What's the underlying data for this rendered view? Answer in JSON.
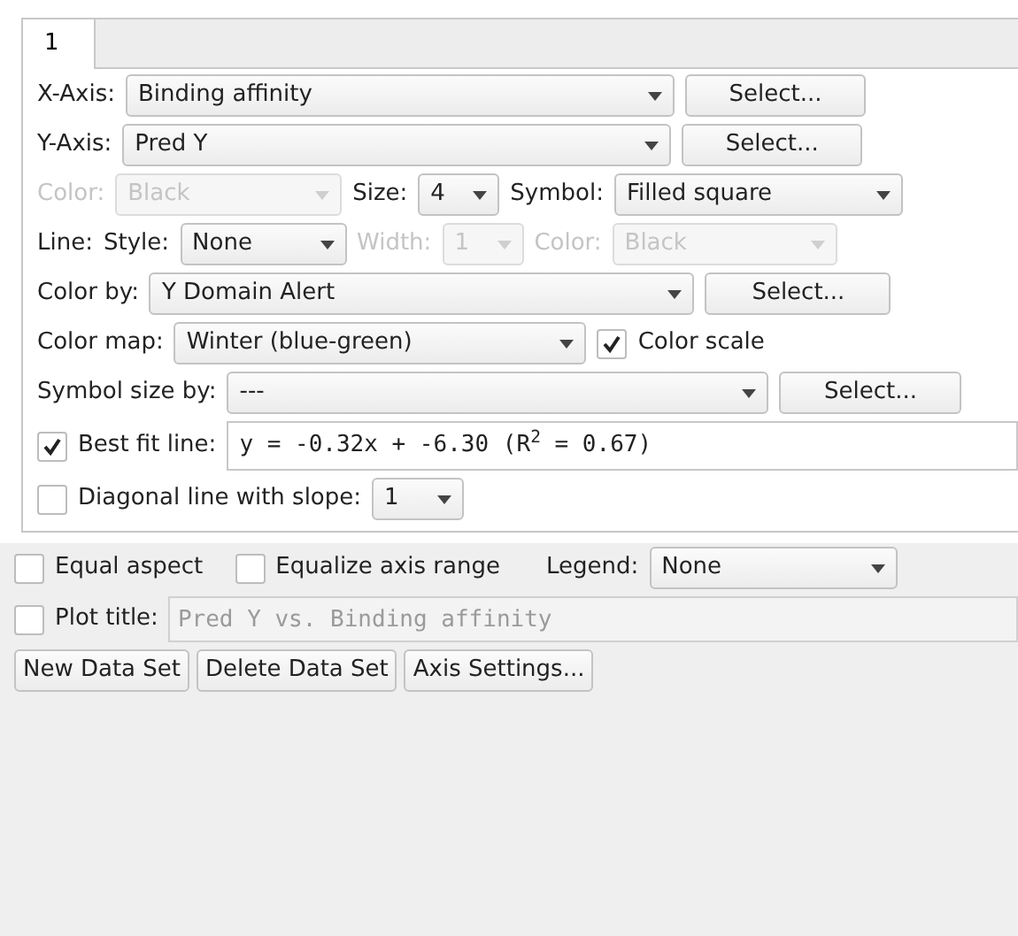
{
  "tabs": [
    {
      "label": "1",
      "selected": true
    }
  ],
  "x_axis": {
    "label": "X-Axis:",
    "value": "Binding affinity",
    "button": "Select..."
  },
  "y_axis": {
    "label": "Y-Axis:",
    "value": "Pred Y",
    "button": "Select..."
  },
  "symbol_row": {
    "color_label": "Color:",
    "color_value": "Black",
    "color_disabled": true,
    "size_label": "Size:",
    "size_value": "4",
    "symbol_label": "Symbol:",
    "symbol_value": "Filled square"
  },
  "line_row": {
    "label": "Line:",
    "style_label": "Style:",
    "style_value": "None",
    "width_label": "Width:",
    "width_value": "1",
    "width_disabled": true,
    "color_label": "Color:",
    "color_value": "Black",
    "color_disabled": true
  },
  "color_by": {
    "label": "Color by:",
    "value": "Y Domain Alert",
    "button": "Select..."
  },
  "color_map": {
    "label": "Color map:",
    "value": "Winter (blue-green)",
    "scale_label": "Color scale",
    "scale_checked": true
  },
  "symbol_size_by": {
    "label": "Symbol size by:",
    "value": "---",
    "button": "Select..."
  },
  "best_fit": {
    "label": "Best fit line:",
    "checked": true,
    "equation": "y = -0.32x + -6.30 (R$^{2}$ = 0.67)"
  },
  "diagonal": {
    "label": "Diagonal line with slope:",
    "checked": false,
    "value": "1"
  },
  "equal_aspect": {
    "label": "Equal aspect",
    "checked": false
  },
  "equalize": {
    "label": "Equalize axis range",
    "checked": false
  },
  "legend": {
    "label": "Legend:",
    "value": "None"
  },
  "plot_title": {
    "label": "Plot title:",
    "checked": false,
    "placeholder": "Pred Y vs. Binding affinity"
  },
  "buttons": [
    "New Data Set",
    "Delete Data Set",
    "Axis Settings..."
  ]
}
